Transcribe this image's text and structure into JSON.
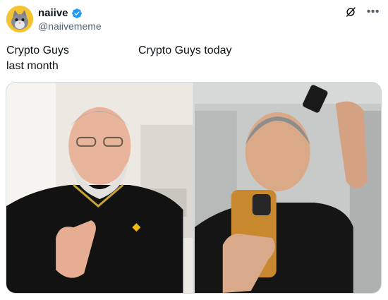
{
  "author": {
    "display_name": "naiive",
    "handle": "@naiivememe"
  },
  "icons": {
    "avatar": "cat-avatar",
    "verified": "verified-badge-icon",
    "grok": "grok-icon",
    "more": "more-icon"
  },
  "colors": {
    "verified_blue": "#1d9bf0",
    "text_primary": "#0f1419",
    "text_secondary": "#536471",
    "avatar_bg": "#f4c430"
  },
  "post": {
    "caption_left": "Crypto Guys\nlast month",
    "caption_right": "Crypto Guys today"
  },
  "media": {
    "left_photo": "man-with-gray-beard-holding-up-four-fingers",
    "right_photo": "man-shaving-head-taking-mirror-selfie"
  }
}
